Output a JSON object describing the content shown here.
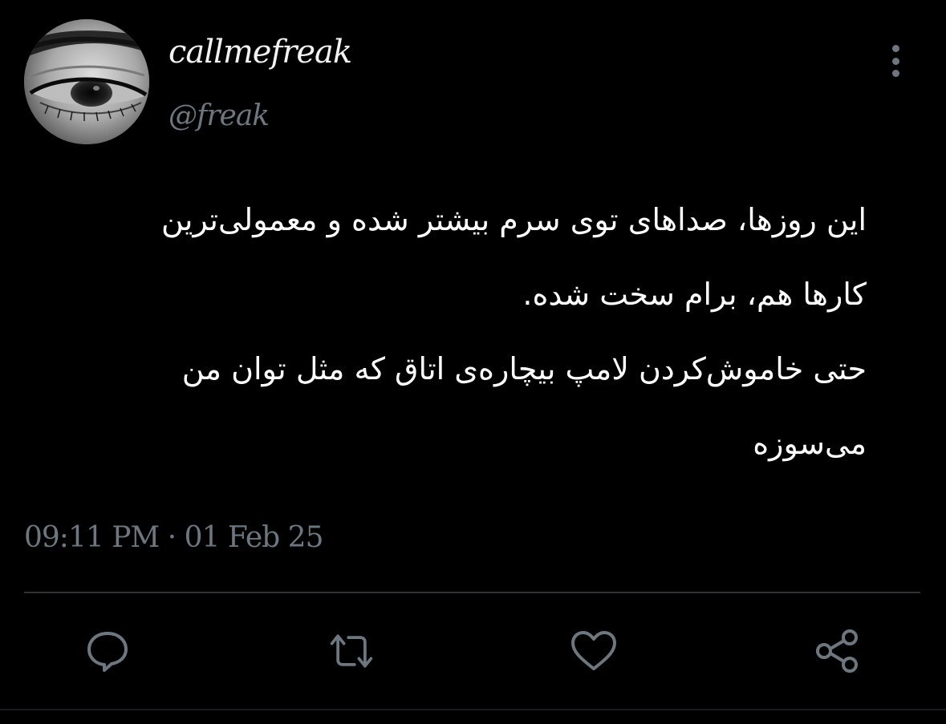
{
  "user": {
    "display_name": "callmefreak",
    "handle": "@freak",
    "avatar_icon": "eye-photo"
  },
  "tweet": {
    "lines": [
      "این روزها، صداهای توی سرم بیشتر شده و معمولی‌ترین",
      "کارها هم، برام سخت شده.",
      "حتی خاموش‌کردن لامپ بیچاره‌ی اتاق که مثل توان من",
      "می‌سوزه"
    ],
    "timestamp": "09:11 PM · 01 Feb 25"
  },
  "actions": {
    "reply_icon": "speech-bubble-icon",
    "retweet_icon": "retweet-icon",
    "like_icon": "heart-icon",
    "share_icon": "share-icon"
  },
  "colors": {
    "background": "#000000",
    "text": "#ffffff",
    "muted": "#6d7780",
    "divider": "#2f3336"
  }
}
